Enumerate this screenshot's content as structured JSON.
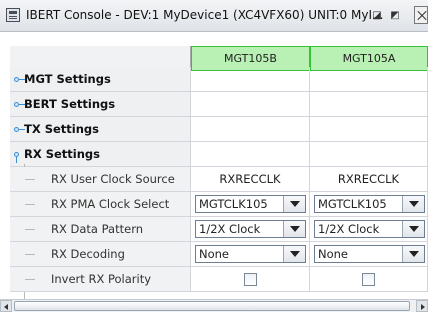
{
  "window": {
    "title": "IBERT Console - DEV:1 MyDevice1 (XC4VFX60) UNIT:0 MyI..."
  },
  "columns": [
    "MGT105B",
    "MGT105A"
  ],
  "sections": [
    {
      "label": "MGT Settings"
    },
    {
      "label": "BERT Settings"
    },
    {
      "label": "TX Settings"
    },
    {
      "label": "RX Settings"
    }
  ],
  "rx_rows": [
    {
      "label": "RX User Clock Source",
      "type": "text",
      "values": [
        "RXRECCLK",
        "RXRECCLK"
      ]
    },
    {
      "label": "RX PMA Clock Select",
      "type": "combo",
      "values": [
        "MGTCLK105",
        "MGTCLK105"
      ]
    },
    {
      "label": "RX Data Pattern",
      "type": "combo",
      "values": [
        "1/2X Clock",
        "1/2X Clock"
      ]
    },
    {
      "label": "RX Decoding",
      "type": "combo",
      "values": [
        "None",
        "None"
      ]
    },
    {
      "label": "Invert RX Polarity",
      "type": "checkbox",
      "values": [
        false,
        false
      ]
    }
  ],
  "icons": {
    "app": "console-icon",
    "handle": "tree-expand-handle",
    "combo": "chevron-down-icon",
    "close": "close-icon"
  },
  "colors": {
    "column_header_bg": "#b9f0b3",
    "column_header_border": "#38c038"
  }
}
